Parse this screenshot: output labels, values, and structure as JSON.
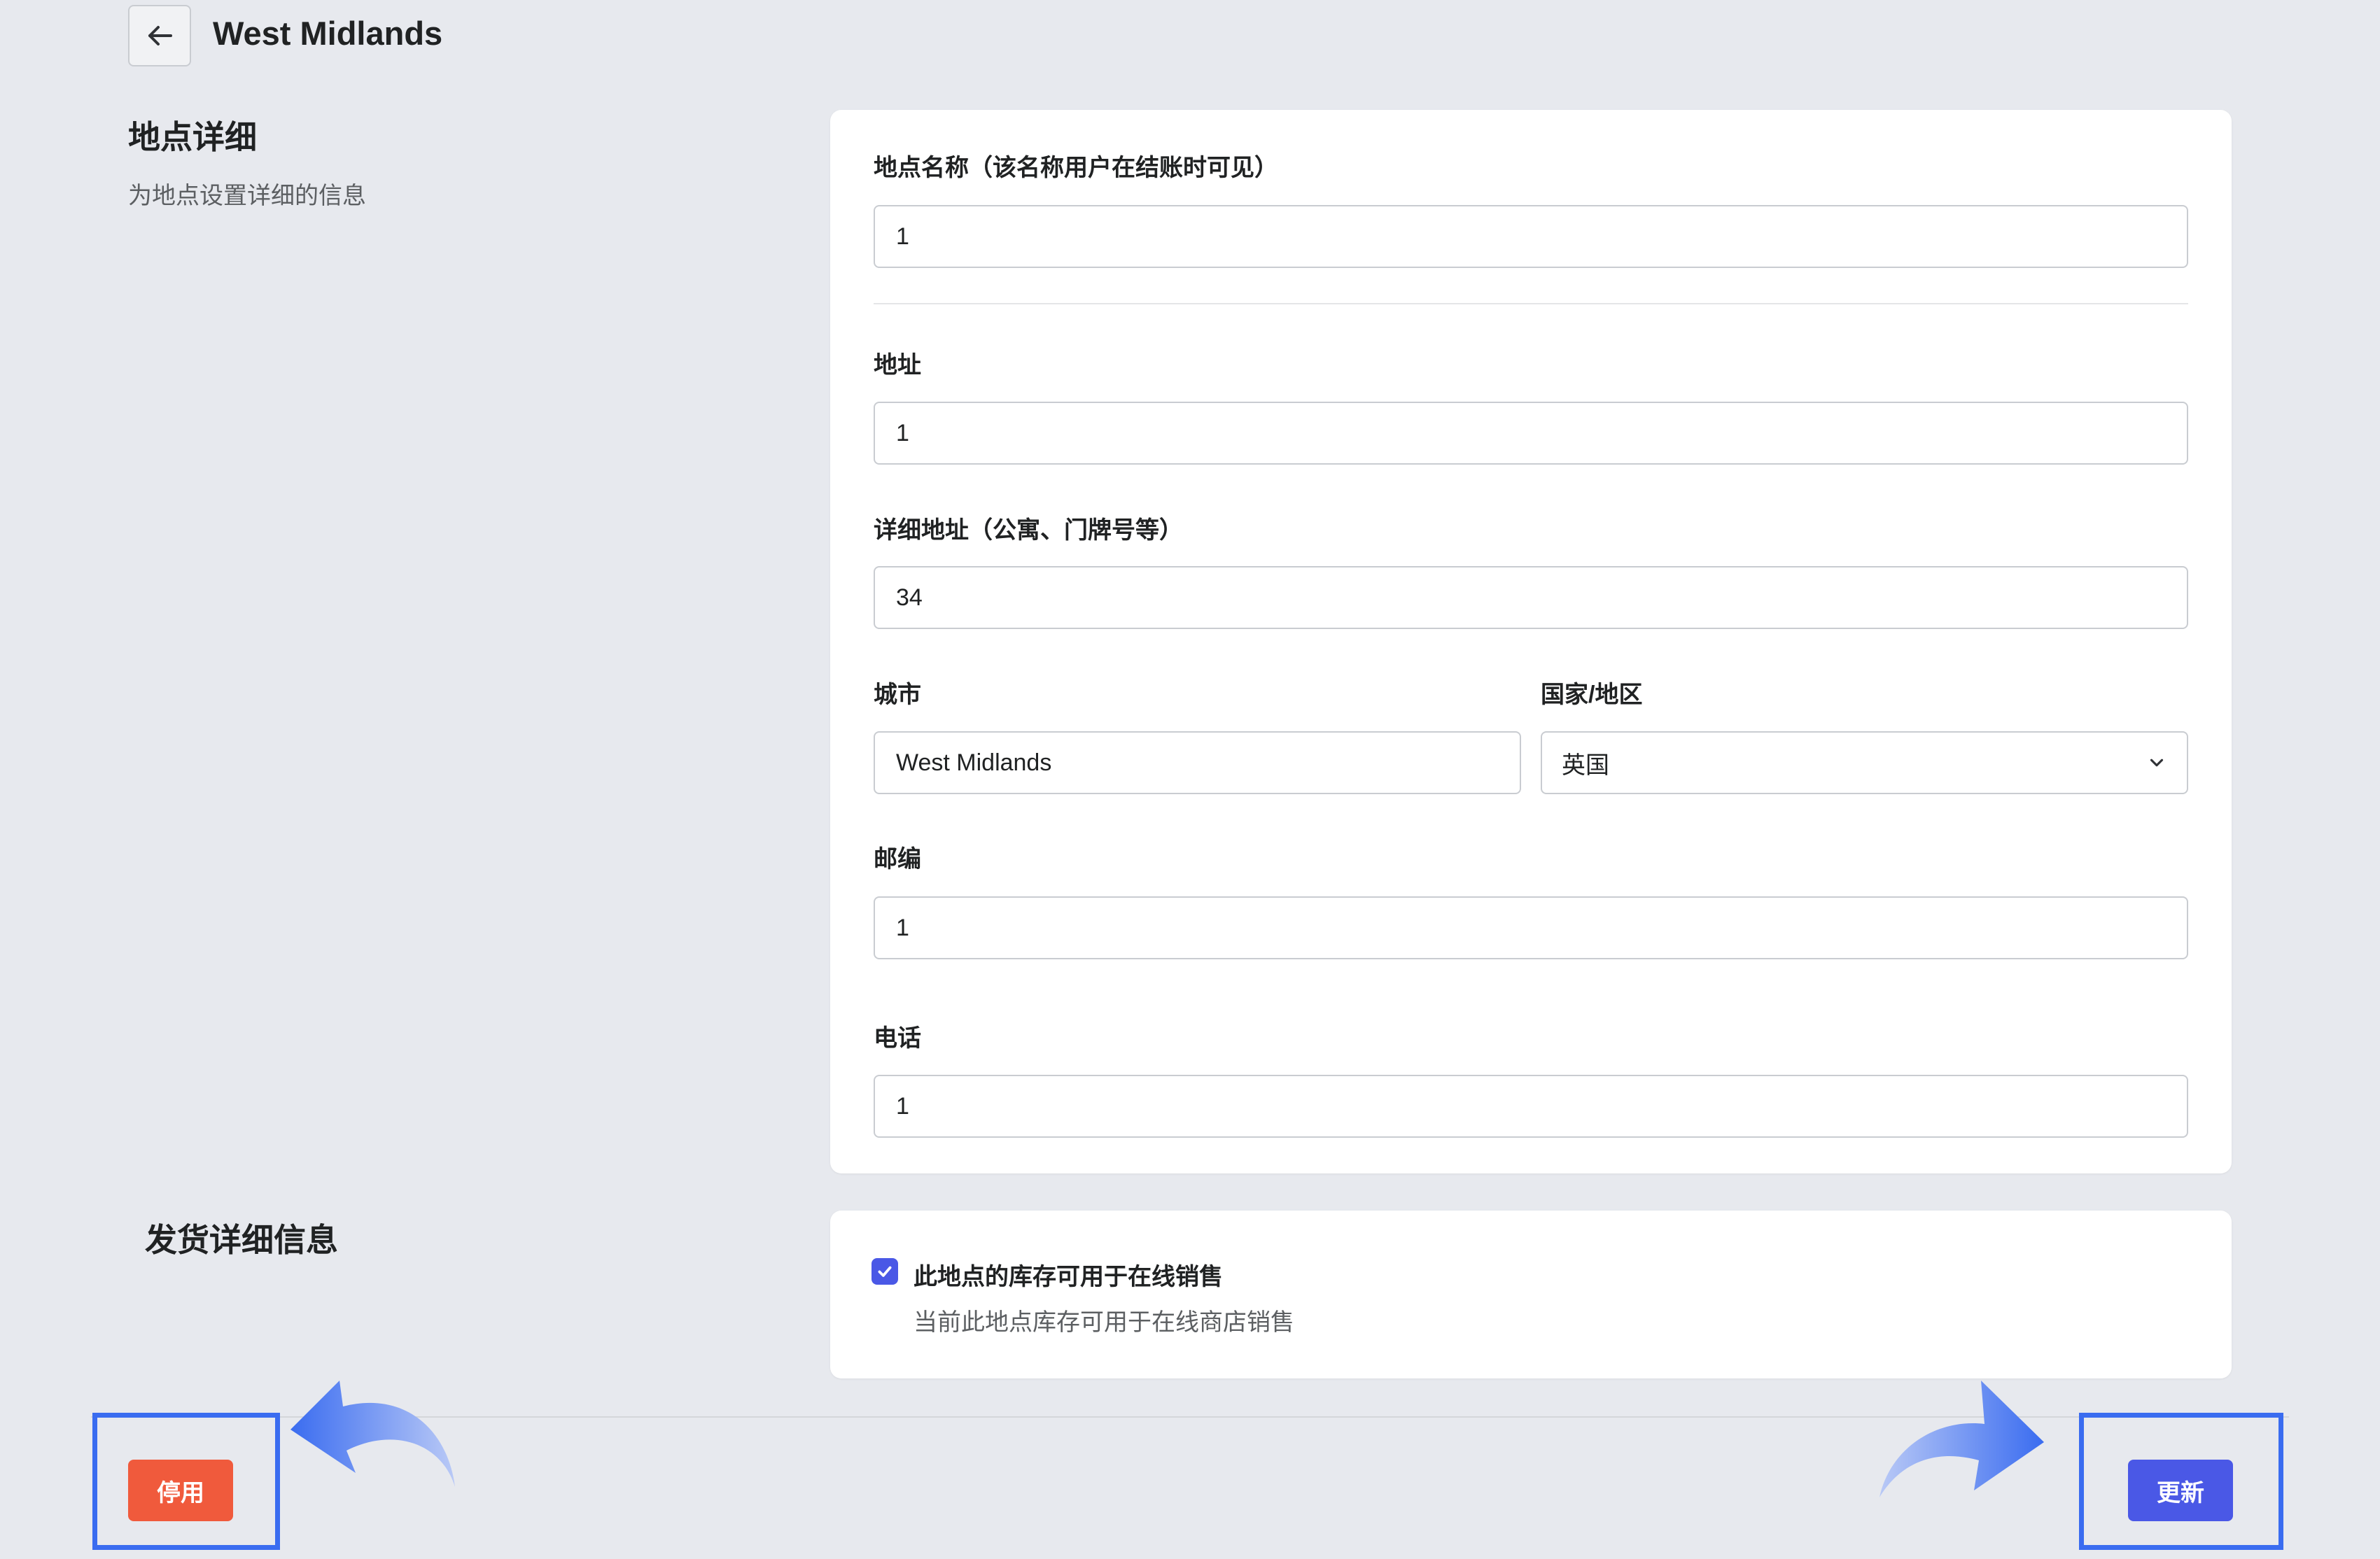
{
  "header": {
    "title": "West Midlands"
  },
  "location_section": {
    "title": "地点详细",
    "subtitle": "为地点设置详细的信息"
  },
  "form": {
    "name": {
      "label": "地点名称（该名称用户在结账时可见）",
      "value": "1"
    },
    "address": {
      "label": "地址",
      "value": "1"
    },
    "address2": {
      "label": "详细地址（公寓、门牌号等）",
      "value": "34"
    },
    "city": {
      "label": "城市",
      "value": "West Midlands"
    },
    "country": {
      "label": "国家/地区",
      "value": "英国"
    },
    "postcode": {
      "label": "邮编",
      "value": "1"
    },
    "phone": {
      "label": "电话",
      "value": "1"
    }
  },
  "shipping_section": {
    "title": "发货详细信息",
    "checkbox_label": "此地点的库存可用于在线销售",
    "checkbox_help": "当前此地点库存可用于在线商店销售",
    "checked": true
  },
  "footer": {
    "deactivate_label": "停用",
    "update_label": "更新"
  },
  "colors": {
    "accent": "#4a58e6",
    "danger": "#f05a3c",
    "annotation": "#3a6cf0"
  },
  "icons": {
    "back": "arrow-left-icon",
    "select": "chevron-down-icon",
    "check": "checkmark-icon"
  }
}
